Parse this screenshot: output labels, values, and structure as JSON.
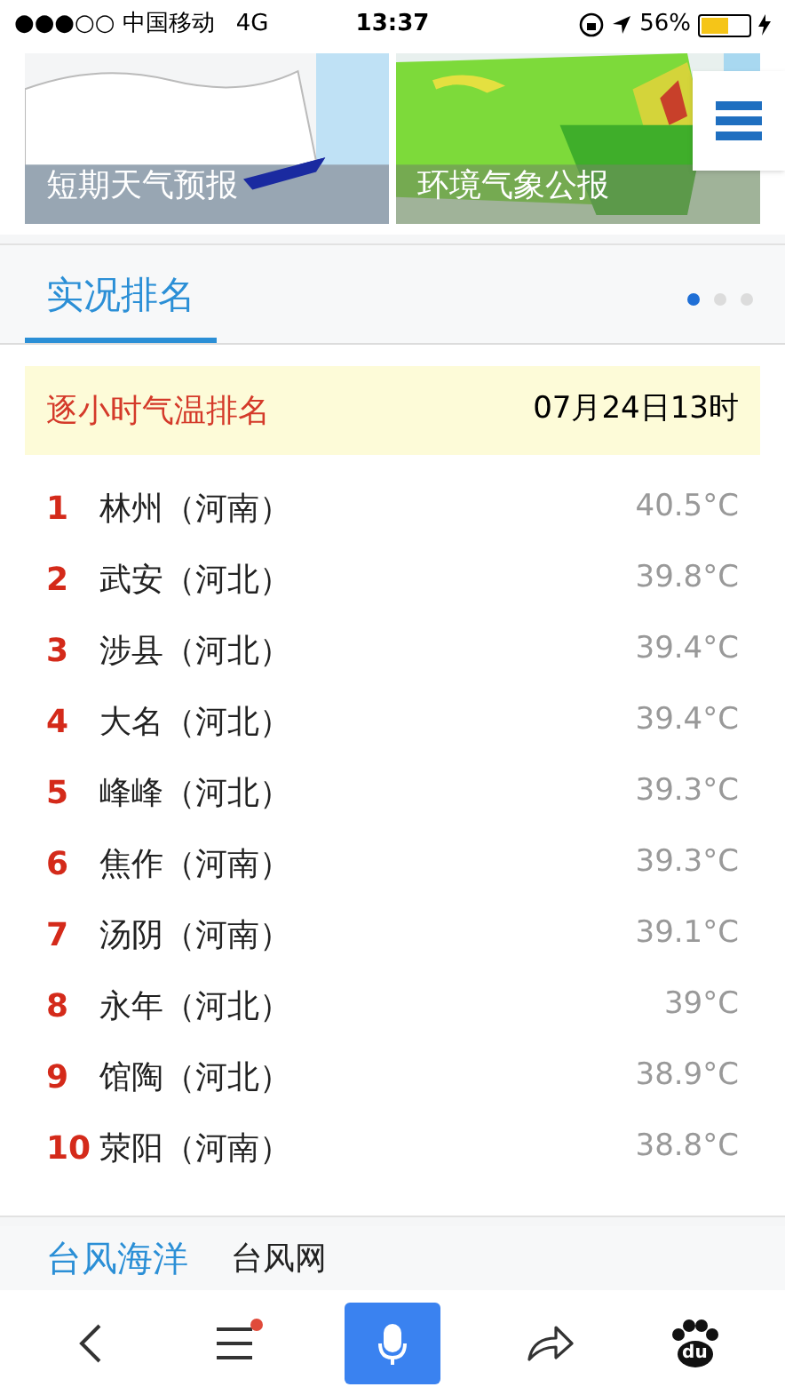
{
  "status_bar": {
    "carrier": "●●●○○ 中国移动",
    "network": "4G",
    "time": "13:37",
    "battery": "56%"
  },
  "map_cards": [
    {
      "caption": "短期天气预报",
      "kind": "picture"
    },
    {
      "caption": "环境气象公报",
      "kind": "picture"
    }
  ],
  "section": {
    "tab": {
      "label": "实况排名",
      "selected": true
    },
    "pages": [
      {
        "selected": true
      },
      {
        "selected": false
      },
      {
        "selected": false
      }
    ]
  },
  "ranking": {
    "title": "逐小时气温排名",
    "time": "07月24日13时",
    "rows": [
      {
        "rank": "1",
        "place": "林州（河南）",
        "temp": "40.5°C"
      },
      {
        "rank": "2",
        "place": "武安（河北）",
        "temp": "39.8°C"
      },
      {
        "rank": "3",
        "place": "涉县（河北）",
        "temp": "39.4°C"
      },
      {
        "rank": "4",
        "place": "大名（河北）",
        "temp": "39.4°C"
      },
      {
        "rank": "5",
        "place": "峰峰（河北）",
        "temp": "39.3°C"
      },
      {
        "rank": "6",
        "place": "焦作（河南）",
        "temp": "39.3°C"
      },
      {
        "rank": "7",
        "place": "汤阴（河南）",
        "temp": "39.1°C"
      },
      {
        "rank": "8",
        "place": "永年（河北）",
        "temp": "39°C"
      },
      {
        "rank": "9",
        "place": "馆陶（河北）",
        "temp": "38.9°C"
      },
      {
        "rank": "10",
        "place": "荥阳（河南）",
        "temp": "38.8°C"
      }
    ]
  },
  "bottom_section": {
    "title": "台风海洋",
    "link": "台风网"
  },
  "toolbar": {
    "menu_badge": true,
    "logo_text": "du"
  }
}
